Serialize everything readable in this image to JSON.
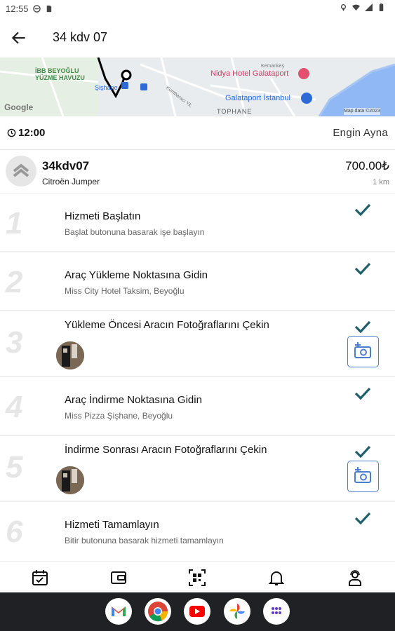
{
  "status_bar": {
    "time": "12:55"
  },
  "app_bar": {
    "title": "34 kdv 07"
  },
  "map": {
    "labels": {
      "ibb_1": "İBB BEYOĞLU",
      "ibb_2": "YÜZME HAVUZU",
      "sishane": "Şişhane",
      "hotel": "Nidya Hotel Galataport",
      "galataport": "Galataport İstanbul",
      "tophane": "TOPHANE",
      "google": "Google",
      "mapdata": "Map data ©2023",
      "street1": "Kumbaracı Yk.",
      "street2": "Kemankeş"
    }
  },
  "info": {
    "time": "12:00",
    "driver": "Engin Ayna"
  },
  "vehicle": {
    "plate": "34kdv07",
    "model": "Citroën Jumper",
    "price": "700.00₺",
    "distance": "1 km"
  },
  "steps": [
    {
      "num": "1",
      "title": "Hizmeti Başlatın",
      "subtitle": "Başlat butonuna basarak işe başlayın"
    },
    {
      "num": "2",
      "title": "Araç Yükleme Noktasına Gidin",
      "subtitle": "Miss City Hotel Taksim, Beyoğlu"
    },
    {
      "num": "3",
      "title": "Yükleme Öncesi Aracın Fotoğraflarını Çekin"
    },
    {
      "num": "4",
      "title": "Araç İndirme Noktasına Gidin",
      "subtitle": "Miss Pizza Şişhane, Beyoğlu"
    },
    {
      "num": "5",
      "title": "İndirme Sonrası Aracın Fotoğraflarını Çekin"
    },
    {
      "num": "6",
      "title": "Hizmeti Tamamlayın",
      "subtitle": "Bitir butonuna basarak hizmeti tamamlayın"
    }
  ],
  "colors": {
    "check": "#1f5f6b",
    "camera": "#4a7fd0",
    "step_number": "#e6e6e6"
  },
  "bottom_nav": [
    "calendar-check-icon",
    "wallet-icon",
    "qr-code-icon",
    "bell-icon",
    "support-agent-icon"
  ],
  "dock": [
    "gmail-icon",
    "chrome-icon",
    "youtube-icon",
    "photos-icon",
    "app-drawer-icon"
  ]
}
